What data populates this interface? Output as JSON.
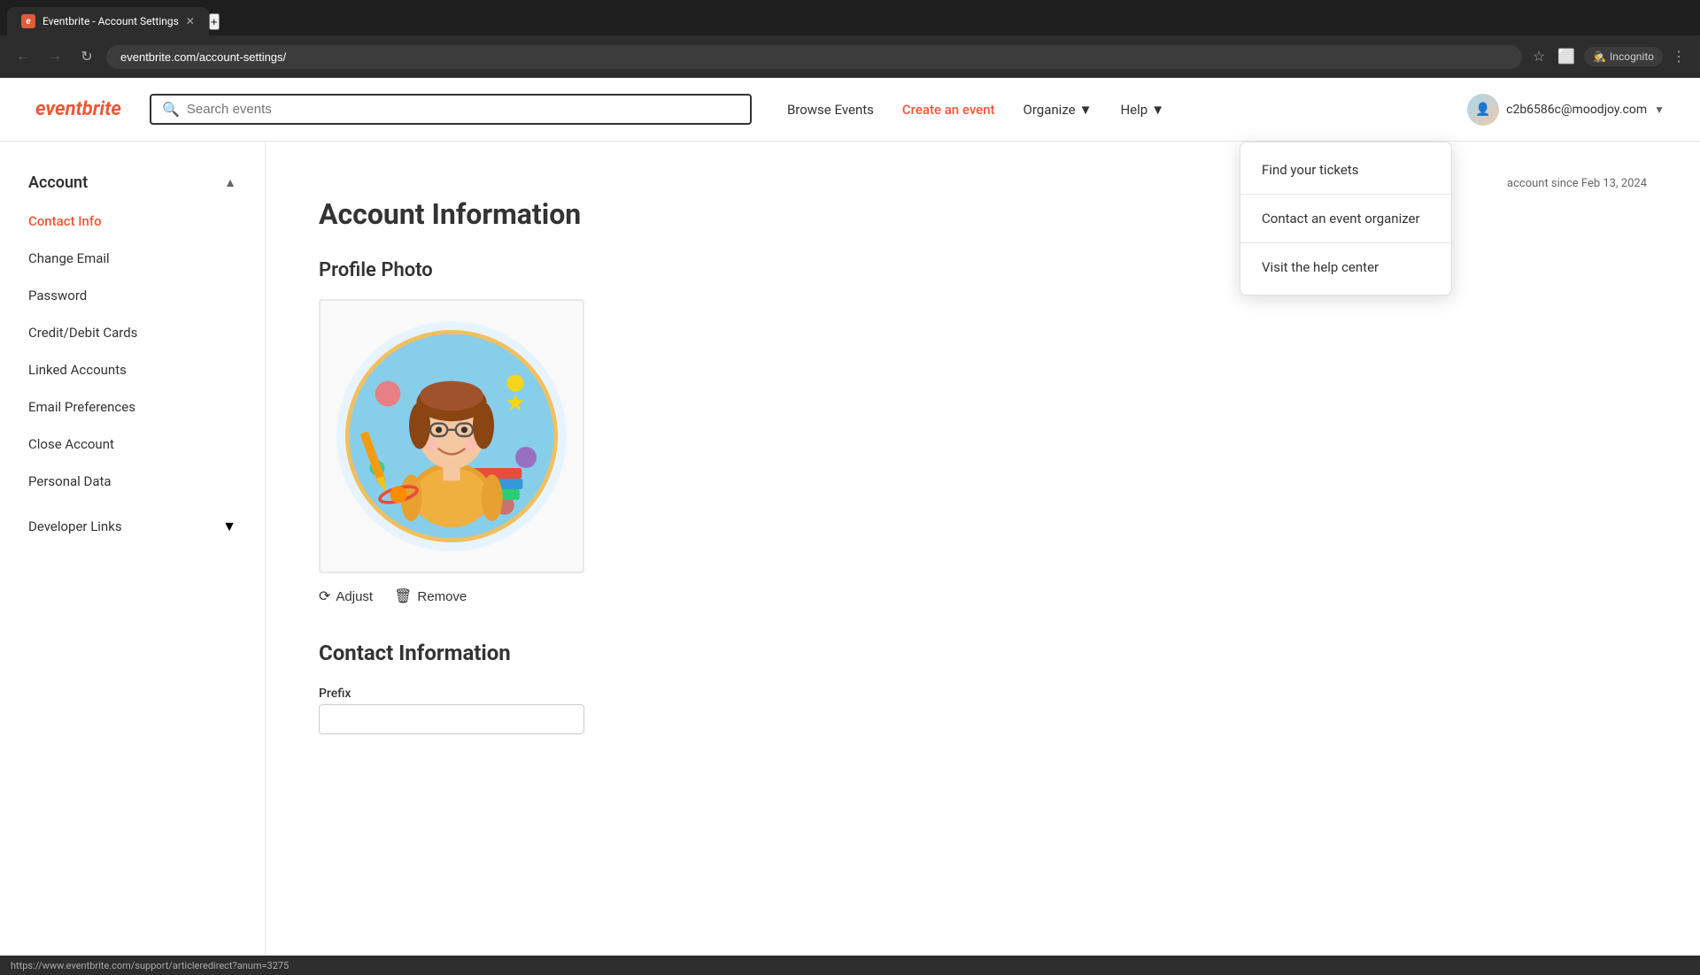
{
  "browser": {
    "tab_title": "Eventbrite - Account Settings",
    "address": "eventbrite.com/account-settings/",
    "new_tab_icon": "+",
    "back_btn": "←",
    "forward_btn": "→",
    "reload_btn": "↻",
    "incognito_label": "Incognito"
  },
  "header": {
    "logo": "eventbrite",
    "search_placeholder": "Search events",
    "nav": {
      "browse_events": "Browse Events",
      "create_event": "Create an event",
      "organize": "Organize",
      "help": "Help"
    },
    "user_email": "c2b6586c@moodjoy.com",
    "account_since": "account since Feb 13, 2024"
  },
  "help_dropdown": {
    "items": [
      {
        "id": "find-tickets",
        "label": "Find your tickets"
      },
      {
        "id": "contact-organizer",
        "label": "Contact an event organizer"
      },
      {
        "id": "help-center",
        "label": "Visit the help center"
      }
    ]
  },
  "sidebar": {
    "account_section": "Account",
    "items": [
      {
        "id": "contact-info",
        "label": "Contact Info"
      },
      {
        "id": "change-email",
        "label": "Change Email"
      },
      {
        "id": "password",
        "label": "Password"
      },
      {
        "id": "credit-debit-cards",
        "label": "Credit/Debit Cards"
      },
      {
        "id": "linked-accounts",
        "label": "Linked Accounts"
      },
      {
        "id": "email-preferences",
        "label": "Email Preferences"
      },
      {
        "id": "close-account",
        "label": "Close Account"
      },
      {
        "id": "personal-data",
        "label": "Personal Data"
      }
    ],
    "developer_links": "Developer Links"
  },
  "main": {
    "page_title": "Account Information",
    "profile_photo_section": "Profile Photo",
    "adjust_btn": "Adjust",
    "remove_btn": "Remove",
    "contact_info_title": "Contact Information",
    "prefix_label": "Prefix"
  },
  "status_bar": {
    "url": "https://www.eventbrite.com/support/articleredirect?anum=3275"
  }
}
